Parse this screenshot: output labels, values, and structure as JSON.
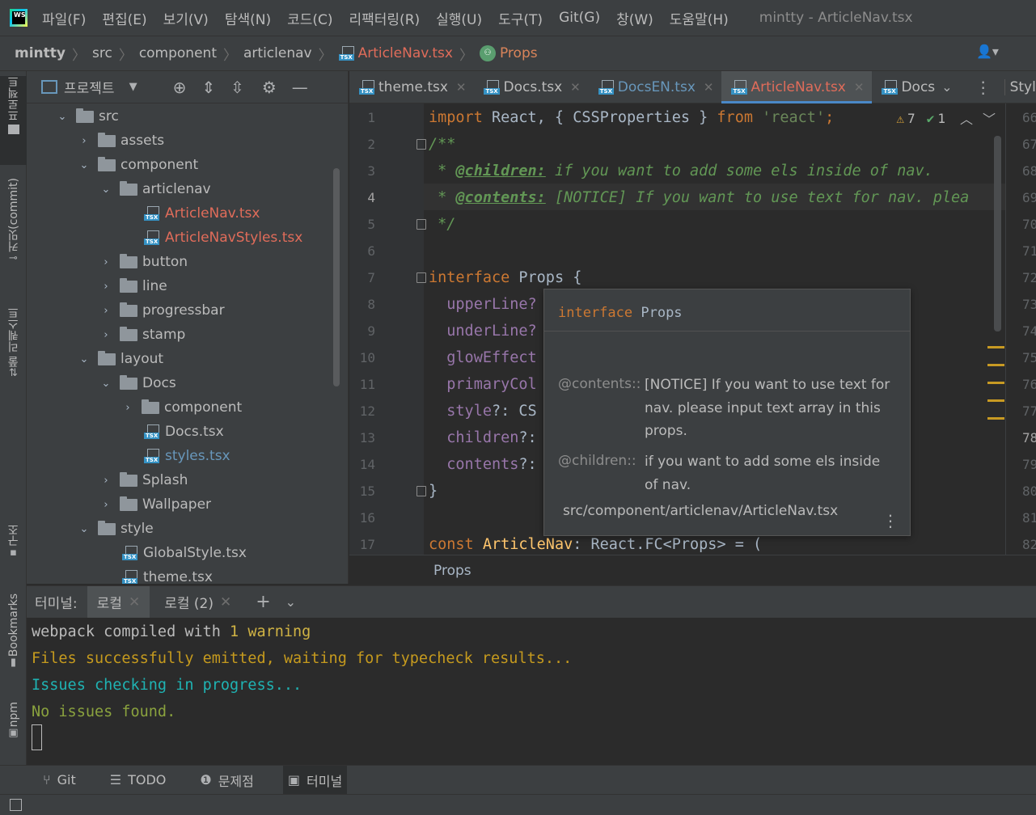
{
  "menubar": {
    "items": [
      "파일(F)",
      "편집(E)",
      "보기(V)",
      "탐색(N)",
      "코드(C)",
      "리팩터링(R)",
      "실행(U)",
      "도구(T)",
      "Git(G)",
      "창(W)",
      "도움말(H)"
    ],
    "window_title": "mintty - ArticleNav.tsx"
  },
  "navbar": {
    "crumbs": [
      "mintty",
      "src",
      "component",
      "articlenav",
      "ArticleNav.tsx",
      "Props"
    ]
  },
  "left_strip": {
    "project": "프로젝트",
    "commit": "커밋(commit)",
    "pull_requests": "풀 리퀘스트",
    "structure": "구조",
    "bookmarks": "Bookmarks",
    "npm": "npm"
  },
  "project_panel": {
    "title": "프로젝트",
    "tree": [
      {
        "label": "src"
      },
      {
        "label": "assets"
      },
      {
        "label": "component"
      },
      {
        "label": "articlenav"
      },
      {
        "label": "ArticleNav.tsx"
      },
      {
        "label": "ArticleNavStyles.tsx"
      },
      {
        "label": "button"
      },
      {
        "label": "line"
      },
      {
        "label": "progressbar"
      },
      {
        "label": "stamp"
      },
      {
        "label": "layout"
      },
      {
        "label": "Docs"
      },
      {
        "label": "component"
      },
      {
        "label": "Docs.tsx"
      },
      {
        "label": "styles.tsx"
      },
      {
        "label": "Splash"
      },
      {
        "label": "Wallpaper"
      },
      {
        "label": "style"
      },
      {
        "label": "GlobalStyle.tsx"
      },
      {
        "label": "theme.tsx"
      }
    ]
  },
  "editor_tabs": {
    "tabs": [
      "theme.tsx",
      "Docs.tsx",
      "DocsEN.tsx",
      "ArticleNav.tsx",
      "Docs"
    ],
    "active": "ArticleNav.tsx",
    "side_tab": "Style"
  },
  "editor": {
    "line_numbers": [
      "1",
      "2",
      "3",
      "4",
      "5",
      "6",
      "7",
      "8",
      "9",
      "10",
      "11",
      "12",
      "13",
      "14",
      "15",
      "16",
      "17"
    ],
    "right_line_numbers": [
      "66",
      "67",
      "68",
      "69",
      "70",
      "71",
      "72",
      "73",
      "74",
      "75",
      "76",
      "77",
      "78",
      "79",
      "80",
      "81",
      "82"
    ],
    "inspections": {
      "warnings": "7",
      "ok": "1"
    },
    "code": {
      "l1_import": "import",
      "l1_react": " React, { CSSProperties } ",
      "l1_from": "from",
      "l1_str": " 'react'",
      "l1_semi": ";",
      "l2": "/**",
      "l3_star": " * ",
      "l3_tag": "@children:",
      "l3_text": " if you want to add some els inside of nav.",
      "l4_star": " * ",
      "l4_tag": "@contents:",
      "l4_text": " [NOTICE] If you want to use text for nav. plea",
      "l5": " */",
      "l7_kw": "interface",
      "l7_name": " Props {",
      "l8": "  upperLine?",
      "l9": "  underLine?",
      "l10": "  glowEffect",
      "l11": "  primaryCol",
      "l12_a": "  style",
      "l12_b": "?: CS",
      "l13_a": "  children",
      "l13_b": "?:",
      "l14_a": "  contents",
      "l14_b": "?:",
      "l15": "}",
      "l17_kw": "const",
      "l17_name": " ArticleNav",
      "l17_rest": ": React.FC<Props> = ("
    },
    "breadcrumb": "Props"
  },
  "tooltip": {
    "head_kw": "interface",
    "head_name": " Props",
    "contents_key": "@contents::",
    "contents_val": "[NOTICE] If you want to use text for nav. please input text array in this props.",
    "children_key": "@children::",
    "children_val": "if you want to add some els inside of nav.",
    "path": "src/component/articlenav/ArticleNav.tsx"
  },
  "terminal": {
    "label": "터미널:",
    "tabs": [
      "로컬",
      "로컬 (2)"
    ],
    "lines": {
      "l1_a": "webpack compiled with ",
      "l1_b": "1 warning",
      "l2": "Files successfully emitted, waiting for typecheck results...",
      "l3": "Issues checking in progress...",
      "l4": "No issues found."
    }
  },
  "bottom_tools": [
    "Git",
    "TODO",
    "문제점",
    "터미널"
  ],
  "colors": {
    "accent": "#4a88c7",
    "keyword": "#cc7832",
    "string": "#6a8759",
    "warning": "#e0a93a"
  }
}
